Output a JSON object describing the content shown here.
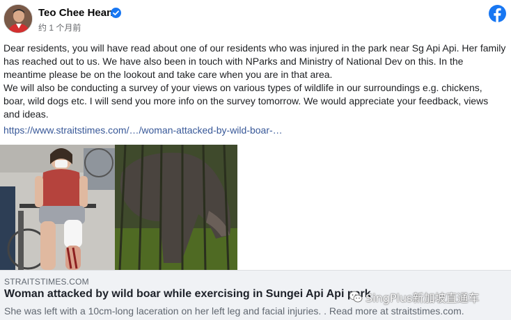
{
  "post": {
    "author": "Teo Chee Hean",
    "timestamp": "约 1 个月前",
    "paragraphs": [
      "Dear residents, you will have read about one of our residents who was injured in the park near Sg Api Api. Her family has reached out to us. We have also been in touch with NParks and Ministry of National Dev on this. In the meantime please be on the lookout and take care when you are in that area.",
      "We will also be conducting a survey of your views on various types of wildlife in our surroundings e.g. chickens, boar, wild dogs etc. I will send you more info on the survey tomorrow. We would appreciate your feedback, views and ideas."
    ],
    "link": "https://www.straitstimes.com/…/woman-attacked-by-wild-boar-…"
  },
  "preview": {
    "source": "STRAITSTIMES.COM",
    "headline": "Woman attacked by wild boar while exercising in Sungei Api Api park",
    "description": "She was left with a 10cm-long laceration on her left leg and facial injuries. . Read more at straitstimes.com."
  },
  "watermark": {
    "text": "SingPlus新加坡直通车"
  },
  "icons": {
    "verified": "verified-badge-icon",
    "facebook": "facebook-logo-icon",
    "watermark": "wechat-icon"
  },
  "colors": {
    "brand": "#1877f2",
    "link": "#385898",
    "preview_bg": "#f0f2f5"
  }
}
